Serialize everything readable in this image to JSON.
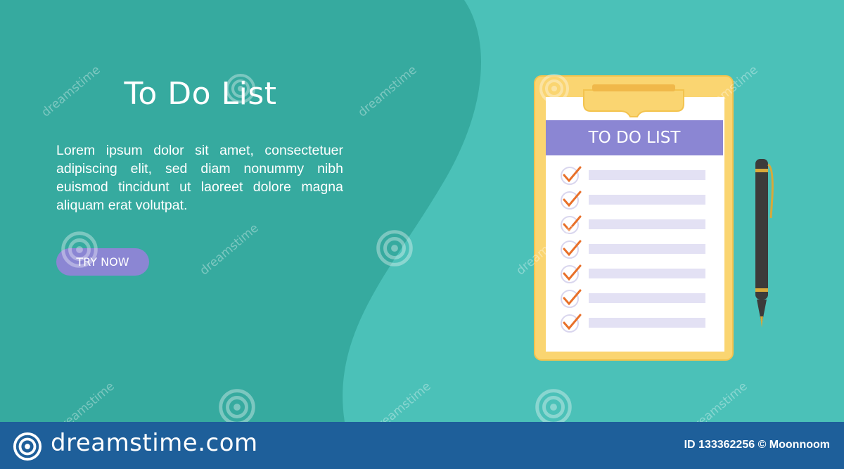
{
  "hero": {
    "title": "To Do List",
    "body": "Lorem ipsum dolor sit amet, consec­tetuer adipiscing elit, sed diam nonum­my nibh euismod tincidunt ut laoreet dolore magna aliquam erat volutpat.",
    "cta_label": "TRY NOW"
  },
  "illustration": {
    "heading": "TO DO LIST",
    "items": [
      {
        "checked": true
      },
      {
        "checked": true
      },
      {
        "checked": true
      },
      {
        "checked": true
      },
      {
        "checked": true
      },
      {
        "checked": true
      },
      {
        "checked": true
      }
    ]
  },
  "watermark": {
    "text": "dreamstime"
  },
  "footer": {
    "brand": "dreamstime.com",
    "credit": "ID 133362256 © Moonnoom"
  },
  "colors": {
    "background": "#4bc1b8",
    "wave": "#36aa9f",
    "button": "#8b86d3",
    "clipboard": "#fad571",
    "heading_bar": "#8b86d3",
    "check": "#e8702a",
    "footer": "#1e5f9a"
  }
}
